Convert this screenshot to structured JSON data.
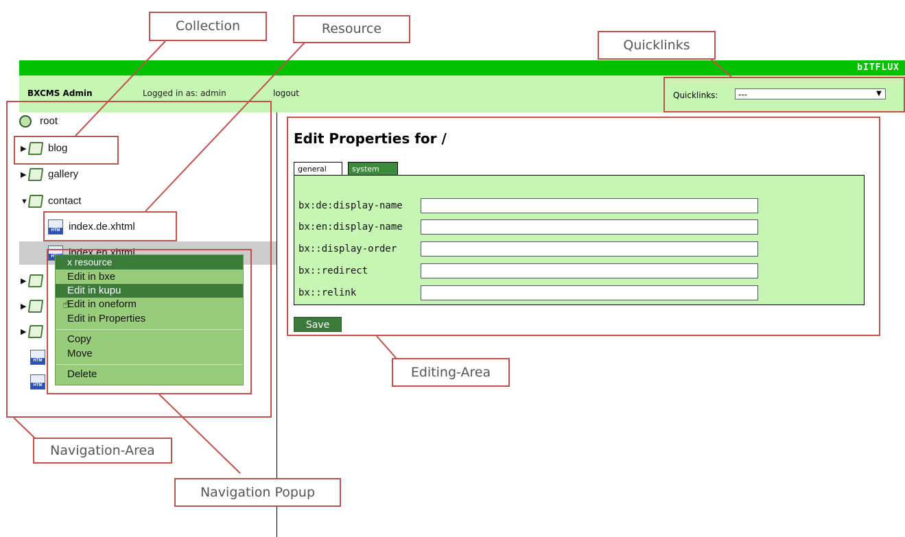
{
  "app": {
    "brand": "bITFLUX",
    "title": "BXCMS Admin",
    "logged_in": "Logged in as: admin",
    "logout": "logout",
    "quicklinks_label": "Quicklinks:",
    "quicklinks_value": "---"
  },
  "tree": {
    "root": "root",
    "items": [
      {
        "label": "blog"
      },
      {
        "label": "gallery"
      },
      {
        "label": "contact"
      },
      {
        "label": "index.de.xhtml"
      },
      {
        "label": "index.en.xhtml"
      }
    ]
  },
  "popup": {
    "title": "x  resource",
    "items": [
      "Edit in bxe",
      "Edit in kupu",
      "Edit in oneform",
      "Edit in Properties",
      "Copy",
      "Move",
      "Delete"
    ]
  },
  "editor": {
    "title": "Edit Properties for /",
    "tabs": [
      "general",
      "system"
    ],
    "fields": [
      {
        "label": "bx:de:display-name",
        "value": ""
      },
      {
        "label": "bx:en:display-name",
        "value": ""
      },
      {
        "label": "bx::display-order",
        "value": ""
      },
      {
        "label": "bx::redirect",
        "value": ""
      },
      {
        "label": "bx::relink",
        "value": ""
      }
    ],
    "save": "Save"
  },
  "annotations": {
    "collection": "Collection",
    "resource": "Resource",
    "quicklinks": "Quicklinks",
    "editing_area": "Editing-Area",
    "navigation_area": "Navigation-Area",
    "navigation_popup": "Navigation Popup"
  },
  "colors": {
    "brand_green": "#00c000",
    "header_green": "#c6f5b4",
    "dark_green": "#3c7a3c",
    "annotation_red": "#c0504d"
  }
}
